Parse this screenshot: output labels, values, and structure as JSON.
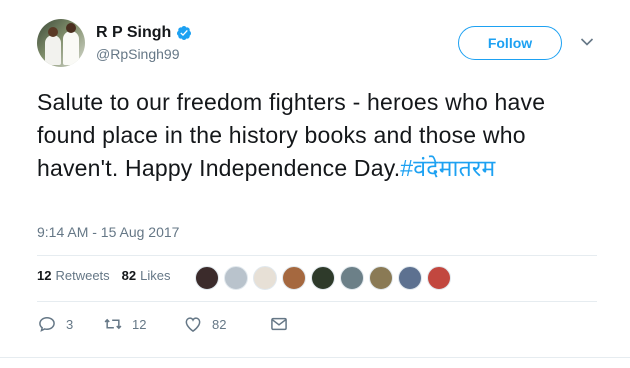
{
  "header": {
    "display_name": "R P Singh",
    "handle": "@RpSingh99",
    "verified_icon": "verified-badge-icon",
    "follow_label": "Follow"
  },
  "tweet": {
    "text": "Salute to our freedom fighters - heroes who have found place in the history books and those who haven't. Happy Independence Day.",
    "hashtag": "#वंदेमातरम",
    "timestamp": "9:14 AM - 15 Aug 2017"
  },
  "stats": {
    "retweets_count": "12",
    "retweets_label": "Retweets",
    "likes_count": "82",
    "likes_label": "Likes"
  },
  "likers": [
    {
      "color": "#3b2b2b"
    },
    {
      "color": "#b9c3cc"
    },
    {
      "color": "#e7e0d6"
    },
    {
      "color": "#a5683f"
    },
    {
      "color": "#2e3a2a"
    },
    {
      "color": "#6c8088"
    },
    {
      "color": "#8a7a55"
    },
    {
      "color": "#5d7190"
    },
    {
      "color": "#c2473f"
    }
  ],
  "actions": {
    "reply_count": "3",
    "retweet_count": "12",
    "like_count": "82"
  },
  "colors": {
    "accent": "#1da1f2",
    "secondary_text": "#657786",
    "divider": "#e6ecf0"
  }
}
